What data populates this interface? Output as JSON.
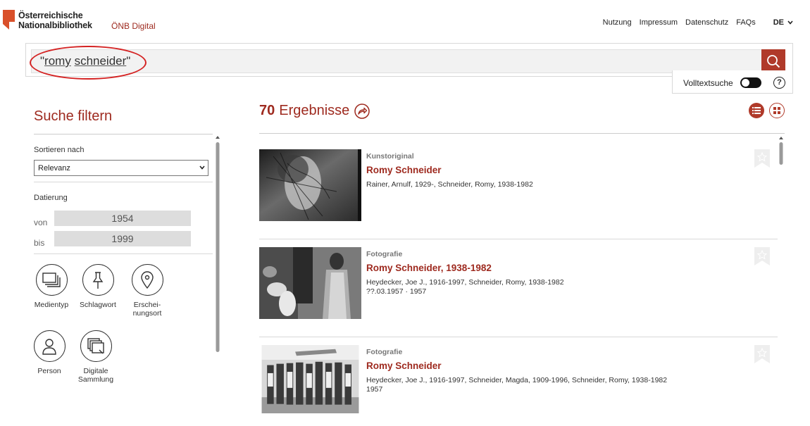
{
  "header": {
    "logo_line1": "Österreichische",
    "logo_line2": "Nationalbibliothek",
    "subtitle": "ÖNB Digital",
    "nav": [
      "Nutzung",
      "Impressum",
      "Datenschutz",
      "FAQs"
    ],
    "lang": "DE"
  },
  "search": {
    "query_open": "\"",
    "query_word1": "romy",
    "query_word2": "schneider",
    "query_close": "\"",
    "fulltext_label": "Volltextsuche",
    "fulltext_enabled": true,
    "help": "?"
  },
  "filter": {
    "title": "Suche filtern",
    "sort_label": "Sortieren nach",
    "sort_value": "Relevanz",
    "date_label": "Datierung",
    "from_label": "von",
    "from_value": "1954",
    "to_label": "bis",
    "to_value": "1999",
    "facets": [
      {
        "label": "Medientyp",
        "icon": "media-type-icon"
      },
      {
        "label": "Schlagwort",
        "icon": "pin-icon"
      },
      {
        "label": "Erschei-nungsort",
        "line1": "Erschei-",
        "line2": "nungsort",
        "icon": "location-icon"
      },
      {
        "label": "Person",
        "icon": "person-icon"
      },
      {
        "label": "Digitale Sammlung",
        "line1": "Digitale",
        "line2": "Sammlung",
        "icon": "collection-icon"
      }
    ]
  },
  "results": {
    "count": "70",
    "label": "Ergebnisse",
    "items": [
      {
        "type": "Kunstoriginal",
        "title": "Romy Schneider",
        "meta1": "Rainer, Arnulf, 1929-, Schneider, Romy, 1938-1982",
        "meta2": ""
      },
      {
        "type": "Fotografie",
        "title": "Romy Schneider, 1938-1982",
        "meta1": "Heydecker, Joe J., 1916-1997, Schneider, Romy, 1938-1982",
        "meta2": "??.03.1957 · 1957"
      },
      {
        "type": "Fotografie",
        "title": "Romy Schneider",
        "meta1": "Heydecker, Joe J., 1916-1997, Schneider, Magda, 1909-1996, Schneider, Romy, 1938-1982",
        "meta2": "1957"
      }
    ]
  },
  "colors": {
    "accent": "#9e2a1f",
    "button": "#b03a2a",
    "annotation": "#d42222"
  }
}
